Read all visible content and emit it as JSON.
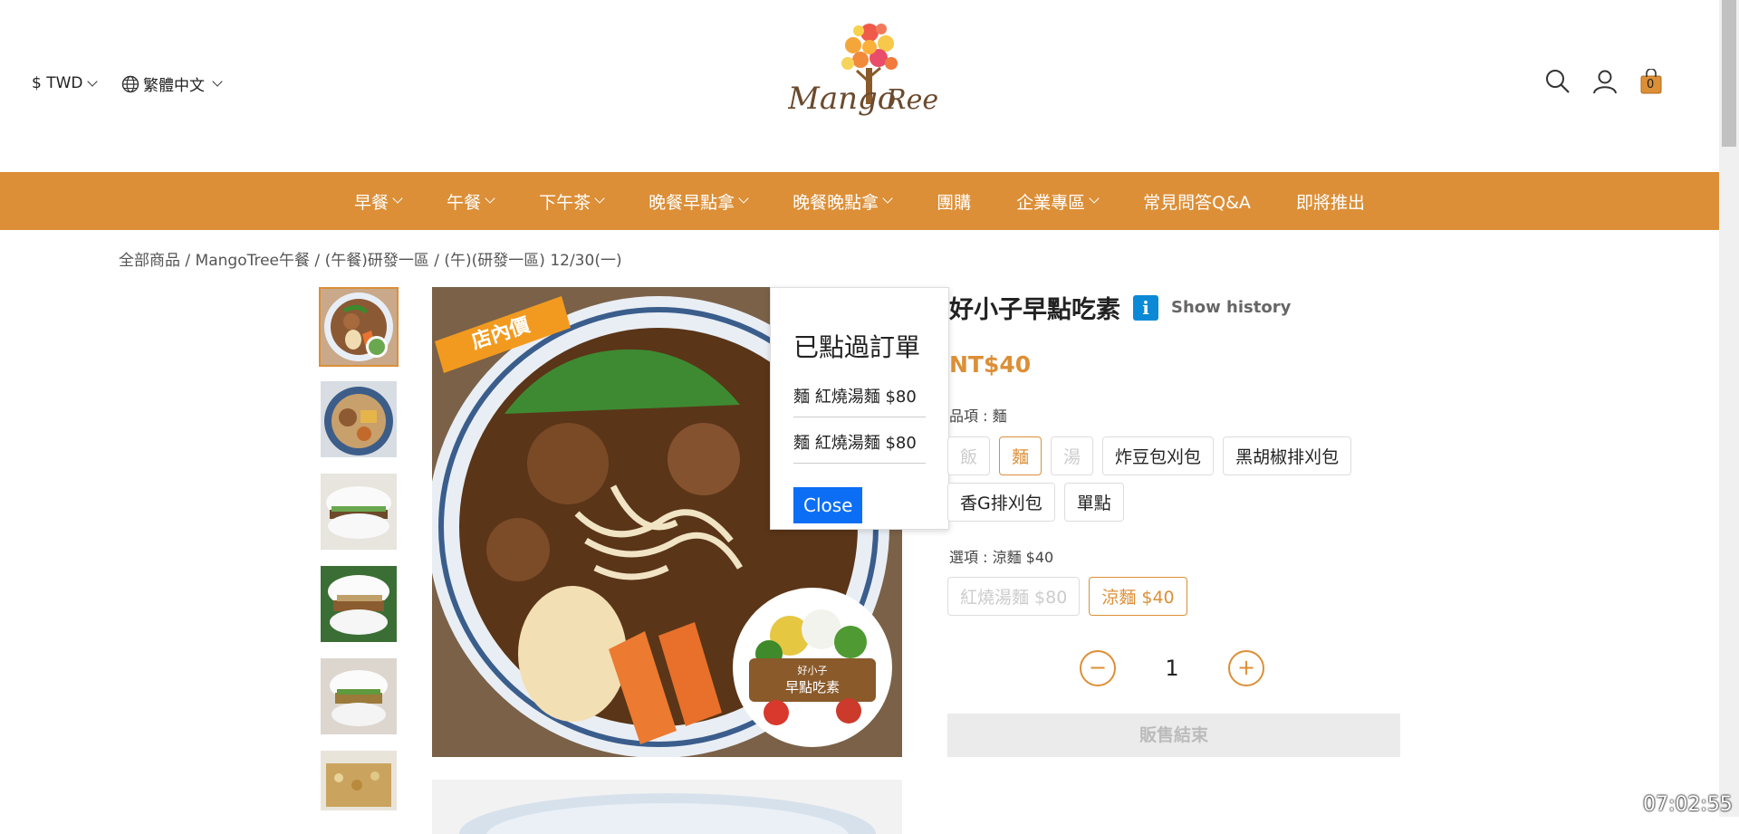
{
  "header": {
    "currency": "$ TWD",
    "language": "繁體中文",
    "cart_count": "0"
  },
  "nav": {
    "items": [
      {
        "label": "早餐",
        "dropdown": true
      },
      {
        "label": "午餐",
        "dropdown": true
      },
      {
        "label": "下午茶",
        "dropdown": true
      },
      {
        "label": "晚餐早點拿",
        "dropdown": true
      },
      {
        "label": "晚餐晚點拿",
        "dropdown": true
      },
      {
        "label": "團購",
        "dropdown": false
      },
      {
        "label": "企業專區",
        "dropdown": true
      },
      {
        "label": "常見問答Q&A",
        "dropdown": false
      },
      {
        "label": "即將推出",
        "dropdown": false
      }
    ]
  },
  "breadcrumb": [
    "全部商品",
    "MangoTree午餐",
    "(午餐)研發一區",
    "(午)(研發一區) 12/30(一)"
  ],
  "product": {
    "title": "好小子早點吃素",
    "info_icon": "i",
    "history_label": "Show history",
    "price": "NT$40",
    "option1_label": "品項 : 麵",
    "option1_chips": [
      {
        "label": "飯",
        "state": "disabled"
      },
      {
        "label": "麵",
        "state": "selected"
      },
      {
        "label": "湯",
        "state": "disabled"
      },
      {
        "label": "炸豆包刈包",
        "state": "normal"
      },
      {
        "label": "黑胡椒排刈包",
        "state": "normal"
      },
      {
        "label": "香G排刈包",
        "state": "normal"
      },
      {
        "label": "單點",
        "state": "normal"
      }
    ],
    "option2_label": "選項 : 涼麵 $40",
    "option2_chips": [
      {
        "label": "紅燒湯麵 $80",
        "state": "disabled"
      },
      {
        "label": "涼麵 $40",
        "state": "selected"
      }
    ],
    "quantity": "1",
    "minus": "−",
    "plus": "+",
    "soldout_label": "販售結束",
    "image_banner": "店內價",
    "badge_text_1": "好小子",
    "badge_text_2": "早點吃素"
  },
  "popup": {
    "title": "已點過訂單",
    "rows": [
      "麵 紅燒湯麵 $80",
      "麵 紅燒湯麵 $80"
    ],
    "close_label": "Close"
  },
  "clock": "07:02:55",
  "colors": {
    "accent": "#dc8f37",
    "button_blue": "#0b6ef5",
    "info_blue": "#0a8ad6"
  }
}
